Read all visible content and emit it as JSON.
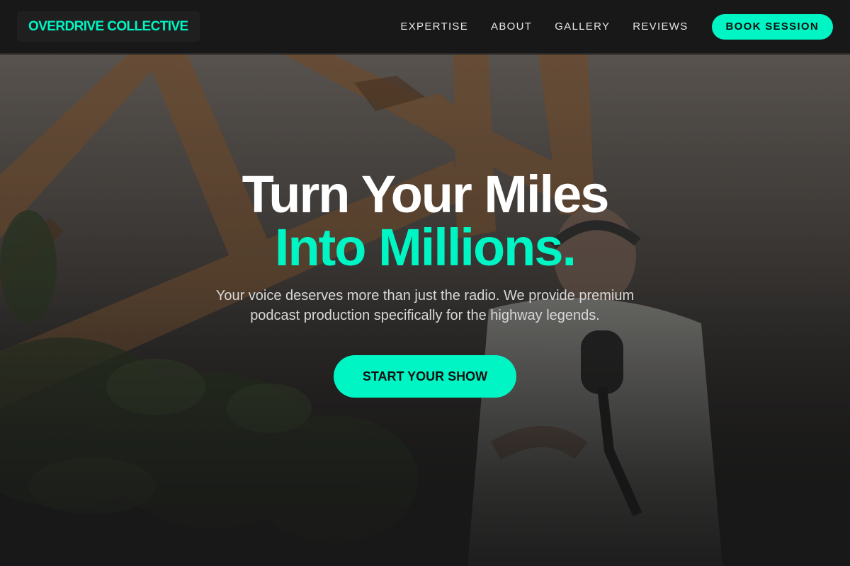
{
  "brand": {
    "name": "OVERDRIVE COLLECTIVE",
    "accent_color": "#00f5c4"
  },
  "nav": {
    "links": [
      {
        "label": "EXPERTISE"
      },
      {
        "label": "ABOUT"
      },
      {
        "label": "GALLERY"
      },
      {
        "label": "REVIEWS"
      }
    ],
    "cta_label": "BOOK SESSION"
  },
  "hero": {
    "headline_line1": "Turn Your Miles",
    "headline_line2": "Into Millions.",
    "subtitle": "Your voice deserves more than just the radio. We provide premium podcast production specifically for the highway legends.",
    "cta_label": "START YOUR SHOW",
    "background": "podcast-studio-photo"
  }
}
